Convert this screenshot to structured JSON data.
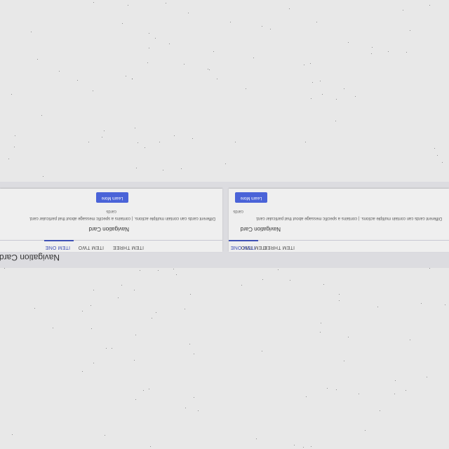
{
  "section": {
    "title": "Navigation Cards"
  },
  "cards": [
    {
      "tabs": [
        "ITEM ONE",
        "ITEM TWO",
        "ITEM THREE"
      ],
      "active_tab": 0,
      "title": "Navigation Card",
      "text": "Different cards can contain multiple actions. | contains a specific message about that particular card.",
      "label": "cards",
      "button_label": "Learn More"
    },
    {
      "tabs": [
        "ITEM ONE",
        "ITEM TWO",
        "ITEM THREE"
      ],
      "active_tab": 0,
      "title": "Navigation Card",
      "text": "Different cards can contain multiple actions. | contains a specific message about that particular card.",
      "label": "cards",
      "button_label": "Learn More"
    }
  ],
  "colors": {
    "background": "#e8e8e8",
    "section_band": "#dcdce0",
    "card": "#efefef",
    "accent": "#3f51b5",
    "button": "#4a63d8"
  }
}
